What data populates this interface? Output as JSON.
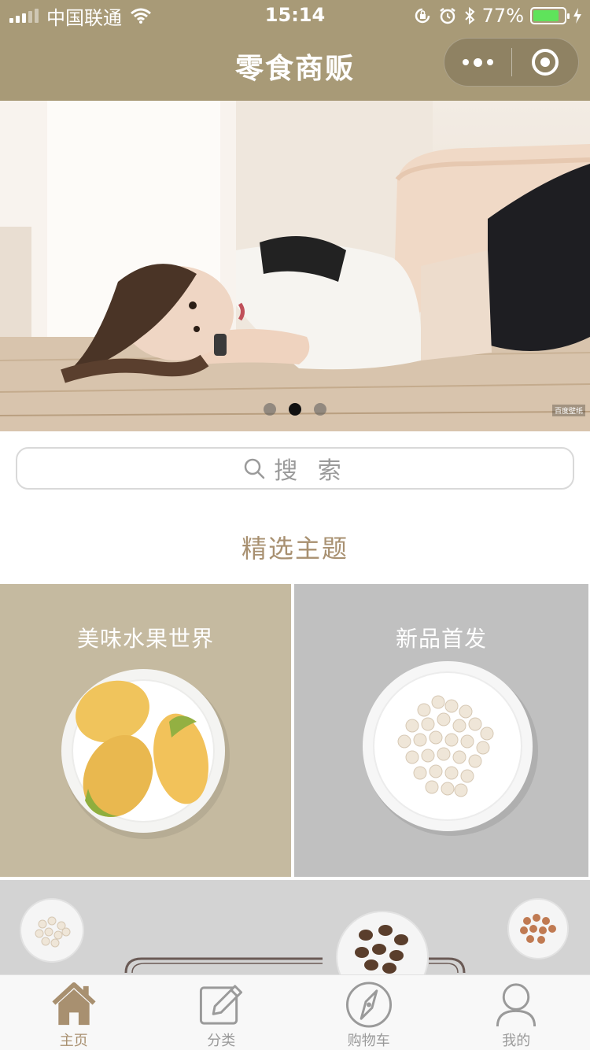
{
  "status_bar": {
    "carrier": "中国联通",
    "time": "15:14",
    "battery_percent": "77%",
    "battery_level": 0.77,
    "icons": [
      "signal-icon",
      "wifi-icon",
      "rotation-lock-icon",
      "alarm-icon",
      "bluetooth-icon",
      "battery-icon",
      "charging-icon"
    ]
  },
  "nav": {
    "title": "零食商贩",
    "more_icon": "more-dots-icon",
    "close_icon": "target-circle-icon"
  },
  "banner": {
    "slide_count": 3,
    "active_index": 1,
    "watermark": "百度壁纸"
  },
  "search": {
    "placeholder": "搜 索"
  },
  "section": {
    "title": "精选主题"
  },
  "themes": [
    {
      "title": "美味水果世界",
      "color": "#c5baa0"
    },
    {
      "title": "新品首发",
      "color": "#c0c0c0"
    },
    {
      "title": "",
      "color": "#d3d3d3"
    }
  ],
  "tab_bar": {
    "items": [
      {
        "label": "主页",
        "icon": "home-icon",
        "active": true
      },
      {
        "label": "分类",
        "icon": "edit-icon",
        "active": false
      },
      {
        "label": "购物车",
        "icon": "compass-icon",
        "active": false
      },
      {
        "label": "我的",
        "icon": "user-icon",
        "active": false
      }
    ],
    "active_color": "#a89070",
    "inactive_color": "#9a9a9a"
  },
  "colors": {
    "brand": "#a89a77",
    "accent_text": "#a89070"
  }
}
